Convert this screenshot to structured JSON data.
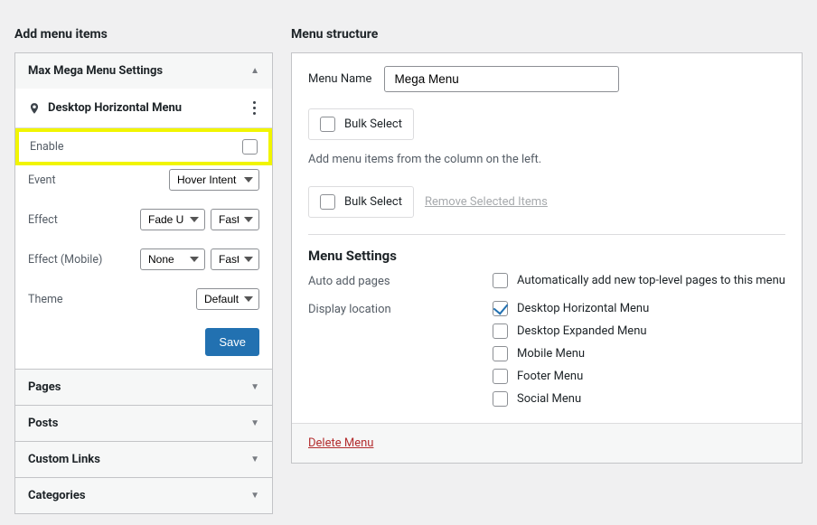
{
  "left": {
    "title": "Add menu items",
    "mmm_header": "Max Mega Menu Settings",
    "location_label": "Desktop Horizontal Menu",
    "rows": {
      "enable": "Enable",
      "event": "Event",
      "effect": "Effect",
      "effect_mobile": "Effect (Mobile)",
      "theme": "Theme"
    },
    "values": {
      "event": "Hover Intent",
      "effect": "Fade Up",
      "effect_speed": "Fast",
      "effect_mobile": "None",
      "effect_mobile_speed": "Fast",
      "theme": "Default"
    },
    "save_label": "Save",
    "accordions": [
      "Pages",
      "Posts",
      "Custom Links",
      "Categories"
    ]
  },
  "right": {
    "title": "Menu structure",
    "menu_name_label": "Menu Name",
    "menu_name_value": "Mega Menu",
    "bulk_select": "Bulk Select",
    "hint": "Add menu items from the column on the left.",
    "remove_selected": "Remove Selected Items",
    "menu_settings_title": "Menu Settings",
    "auto_add_label": "Auto add pages",
    "auto_add_option": "Automatically add new top-level pages to this menu",
    "display_location_label": "Display location",
    "locations": [
      {
        "label": "Desktop Horizontal Menu",
        "checked": true
      },
      {
        "label": "Desktop Expanded Menu",
        "checked": false
      },
      {
        "label": "Mobile Menu",
        "checked": false
      },
      {
        "label": "Footer Menu",
        "checked": false
      },
      {
        "label": "Social Menu",
        "checked": false
      }
    ],
    "delete_label": "Delete Menu"
  }
}
